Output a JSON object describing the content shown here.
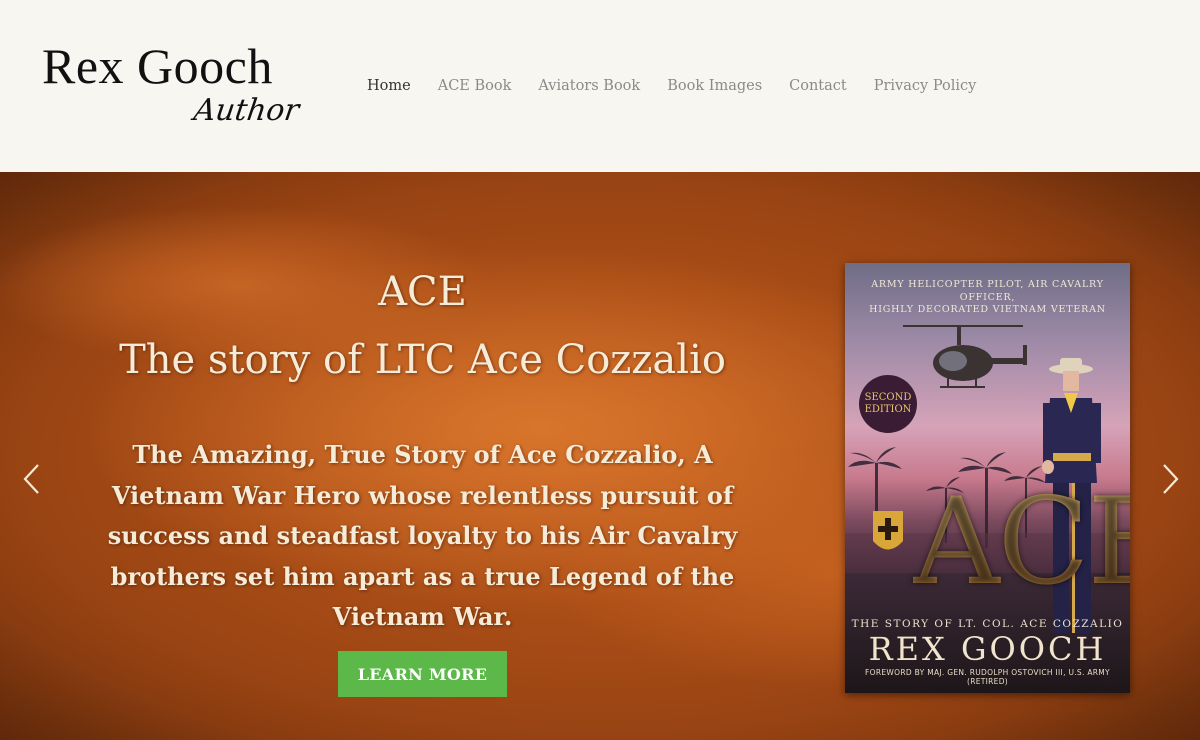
{
  "header": {
    "logo_name": "Rex Gooch",
    "logo_subtitle": "Author",
    "nav": [
      {
        "label": "Home",
        "active": true
      },
      {
        "label": "ACE Book",
        "active": false
      },
      {
        "label": "Aviators Book",
        "active": false
      },
      {
        "label": "Book Images",
        "active": false
      },
      {
        "label": "Contact",
        "active": false
      },
      {
        "label": "Privacy Policy",
        "active": false
      }
    ]
  },
  "hero": {
    "title_line1": "ACE",
    "title_line2": "The story of LTC Ace Cozzalio",
    "description": "The Amazing, True Story of Ace Cozzalio, A Vietnam War Hero whose relentless pursuit of success and steadfast loyalty to his Air Cavalry brothers set him apart as a true Legend of the Vietnam War.",
    "cta_label": "LEARN MORE",
    "prev_icon": "chevron-left-icon",
    "next_icon": "chevron-right-icon",
    "cta_color": "#5db84a"
  },
  "book_cover": {
    "tagline_line1": "ARMY HELICOPTER PILOT, AIR CAVALRY OFFICER,",
    "tagline_line2": "HIGHLY DECORATED VIETNAM VETERAN",
    "badge_line1": "SECOND",
    "badge_line2": "EDITION",
    "title": "ACE",
    "subtitle": "THE STORY OF LT. COL. ACE COZZALIO",
    "author": "REX GOOCH",
    "foreword": "FOREWORD BY MAJ. GEN. RUDOLPH OSTOVICH III, U.S. ARMY (RETIRED)"
  }
}
